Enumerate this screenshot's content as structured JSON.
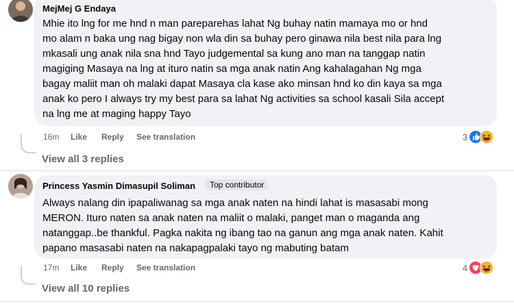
{
  "comments": [
    {
      "author": "MejMej G Endaya",
      "badge": "",
      "lines": [
        "Mhie ito lng for me hnd n man pareparehas lahat Ng buhay natin mamaya mo or hnd",
        "mo alam n baka ung nag bigay non wla din sa buhay pero ginawa nila best nila para lng",
        "mkasali ung anak nila sna hnd Tayo judgemental sa kung ano man na tanggap natin",
        "magiging Masaya na lng at ituro natin sa mga anak natin Ang kahalagahan Ng mga",
        "bagay maliit man oh malaki dapat Masaya cla kase ako minsan hnd ko din kaya sa mga",
        "anak ko pero I always try my best para sa lahat Ng activities sa school kasali Sila accept",
        "na lng me at maging happy Tayo"
      ],
      "time": "16m",
      "like": "Like",
      "reply": "Reply",
      "translate": "See translation",
      "reaction_count": "3",
      "reaction_icons": [
        "like-icon",
        "haha-icon"
      ],
      "view_replies": "View all 3 replies"
    },
    {
      "author": "Princess Yasmin Dimasupil Soliman",
      "badge": "Top contributor",
      "lines": [
        "Always nalang din ipapaliwanag sa mga anak naten na hindi lahat is masasabi mong",
        "MERON. Ituro naten sa anak naten na maliit o malaki, panget man o maganda ang",
        "natanggap..be thankful. Pagka nakita ng ibang tao na ganun ang mga anak naten. Kahit",
        "papano masasabi naten na nakapagpalaki tayo ng mabuting batam"
      ],
      "time": "17m",
      "like": "Like",
      "reply": "Reply",
      "translate": "See translation",
      "reaction_count": "4",
      "reaction_icons": [
        "love-icon",
        "haha-icon"
      ],
      "view_replies": "View all 10 replies"
    }
  ],
  "colors": {
    "bubble": "#f0f2f5",
    "meta_text": "#65676b",
    "like_blue": "#1877f2",
    "love_red": "#f33e58",
    "haha_yellow": "#f7b125"
  }
}
